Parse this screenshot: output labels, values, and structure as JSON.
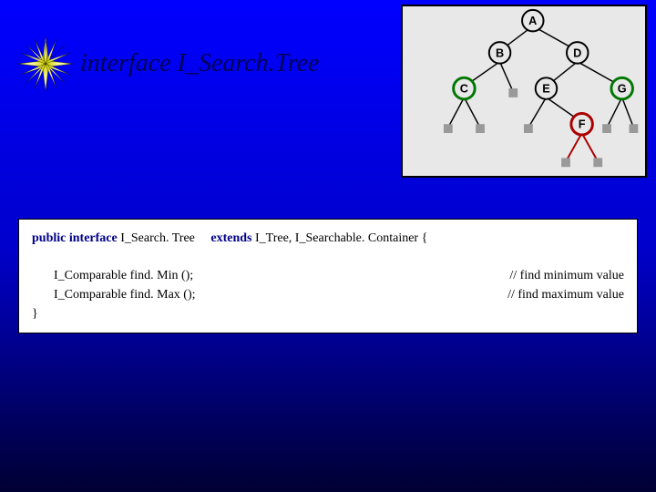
{
  "title": "interface I_Search.Tree",
  "tree": {
    "nodes": {
      "A": "A",
      "B": "B",
      "C": "C",
      "D": "D",
      "E": "E",
      "F": "F",
      "G": "G"
    }
  },
  "code": {
    "decl_public": "public",
    "decl_interface": "interface",
    "decl_name": "I_Search. Tree",
    "decl_extends": "extends",
    "decl_supers": "I_Tree, I_Searchable. Container {",
    "method1": "I_Comparable find. Min ();",
    "method1_comment": "// find minimum value",
    "method2": "I_Comparable find. Max ();",
    "method2_comment": "// find maximum value",
    "close": "}"
  }
}
